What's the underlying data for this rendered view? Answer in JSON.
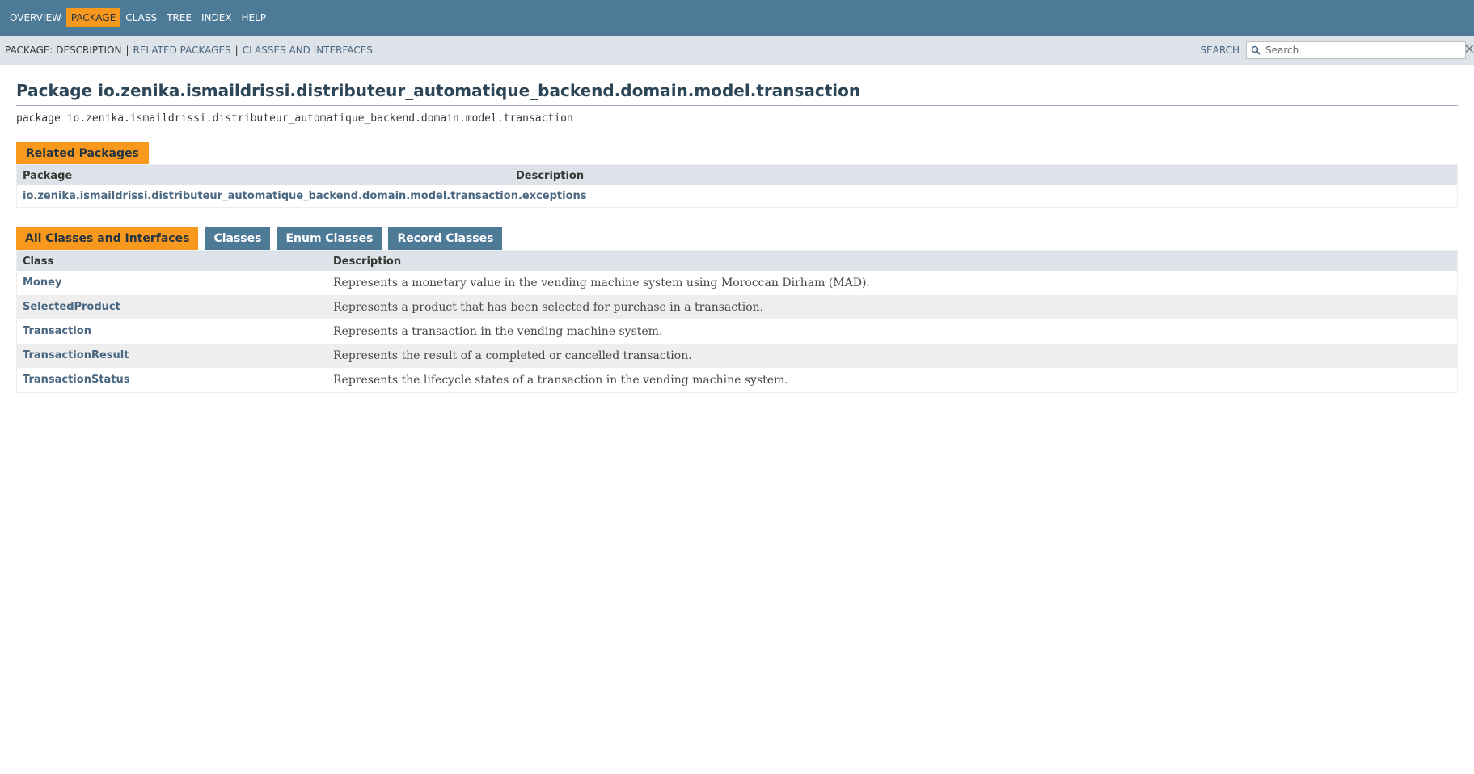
{
  "top_nav": {
    "items": [
      {
        "label": "OVERVIEW"
      },
      {
        "label": "PACKAGE"
      },
      {
        "label": "CLASS"
      },
      {
        "label": "TREE"
      },
      {
        "label": "INDEX"
      },
      {
        "label": "HELP"
      }
    ],
    "active": "PACKAGE"
  },
  "sub_nav": {
    "label": "PACKAGE: DESCRIPTION",
    "links": [
      {
        "label": "RELATED PACKAGES"
      },
      {
        "label": "CLASSES AND INTERFACES"
      }
    ],
    "separator": "|"
  },
  "search": {
    "label": "SEARCH",
    "placeholder": "Search",
    "value": ""
  },
  "header": {
    "title": "Package io.zenika.ismaildrissi.distributeur_automatique_backend.domain.model.transaction",
    "signature": "package io.zenika.ismaildrissi.distributeur_automatique_backend.domain.model.transaction"
  },
  "related_packages": {
    "caption": "Related Packages",
    "columns": [
      "Package",
      "Description"
    ],
    "rows": [
      {
        "name": "io.zenika.ismaildrissi.distributeur_automatique_backend.domain.model.transaction.exceptions",
        "description": ""
      }
    ]
  },
  "classes": {
    "tabs": [
      {
        "label": "All Classes and Interfaces"
      },
      {
        "label": "Classes"
      },
      {
        "label": "Enum Classes"
      },
      {
        "label": "Record Classes"
      }
    ],
    "active_tab": "All Classes and Interfaces",
    "columns": [
      "Class",
      "Description"
    ],
    "rows": [
      {
        "name": "Money",
        "description": "Represents a monetary value in the vending machine system using Moroccan Dirham (MAD)."
      },
      {
        "name": "SelectedProduct",
        "description": "Represents a product that has been selected for purchase in a transaction."
      },
      {
        "name": "Transaction",
        "description": "Represents a transaction in the vending machine system."
      },
      {
        "name": "TransactionResult",
        "description": "Represents the result of a completed or cancelled transaction."
      },
      {
        "name": "TransactionStatus",
        "description": "Represents the lifecycle states of a transaction in the vending machine system."
      }
    ]
  },
  "colors": {
    "nav_bg": "#4D7A97",
    "active_accent": "#F8981D",
    "subnav_bg": "#dee3e9",
    "link": "#4A6782"
  },
  "icons": {
    "search": "magnifier-icon",
    "reset": "close-icon"
  }
}
